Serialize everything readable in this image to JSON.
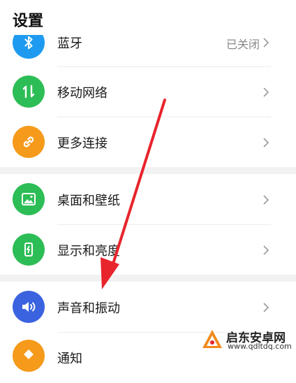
{
  "header": {
    "title": "设置"
  },
  "items": [
    {
      "label": "蓝牙",
      "status": "已关闭",
      "icon": "bluetooth-icon",
      "color": "#1e9bf0"
    },
    {
      "label": "移动网络",
      "icon": "mobile-data-icon",
      "color": "#2dbd56"
    },
    {
      "label": "更多连接",
      "icon": "link-icon",
      "color": "#f59a1b"
    },
    {
      "label": "桌面和壁纸",
      "icon": "wallpaper-icon",
      "color": "#2dbd56"
    },
    {
      "label": "显示和亮度",
      "icon": "brightness-icon",
      "color": "#2dbd56"
    },
    {
      "label": "声音和振动",
      "icon": "speaker-icon",
      "color": "#3b63e0"
    },
    {
      "label": "通知",
      "icon": "bell-icon",
      "color": "#f59a1b"
    }
  ],
  "watermark": {
    "name": "启东安卓网",
    "url": "www.qdltdq.com"
  },
  "colors": {
    "arrow": "#e8242c",
    "section_gap": "#f2f2f2"
  }
}
